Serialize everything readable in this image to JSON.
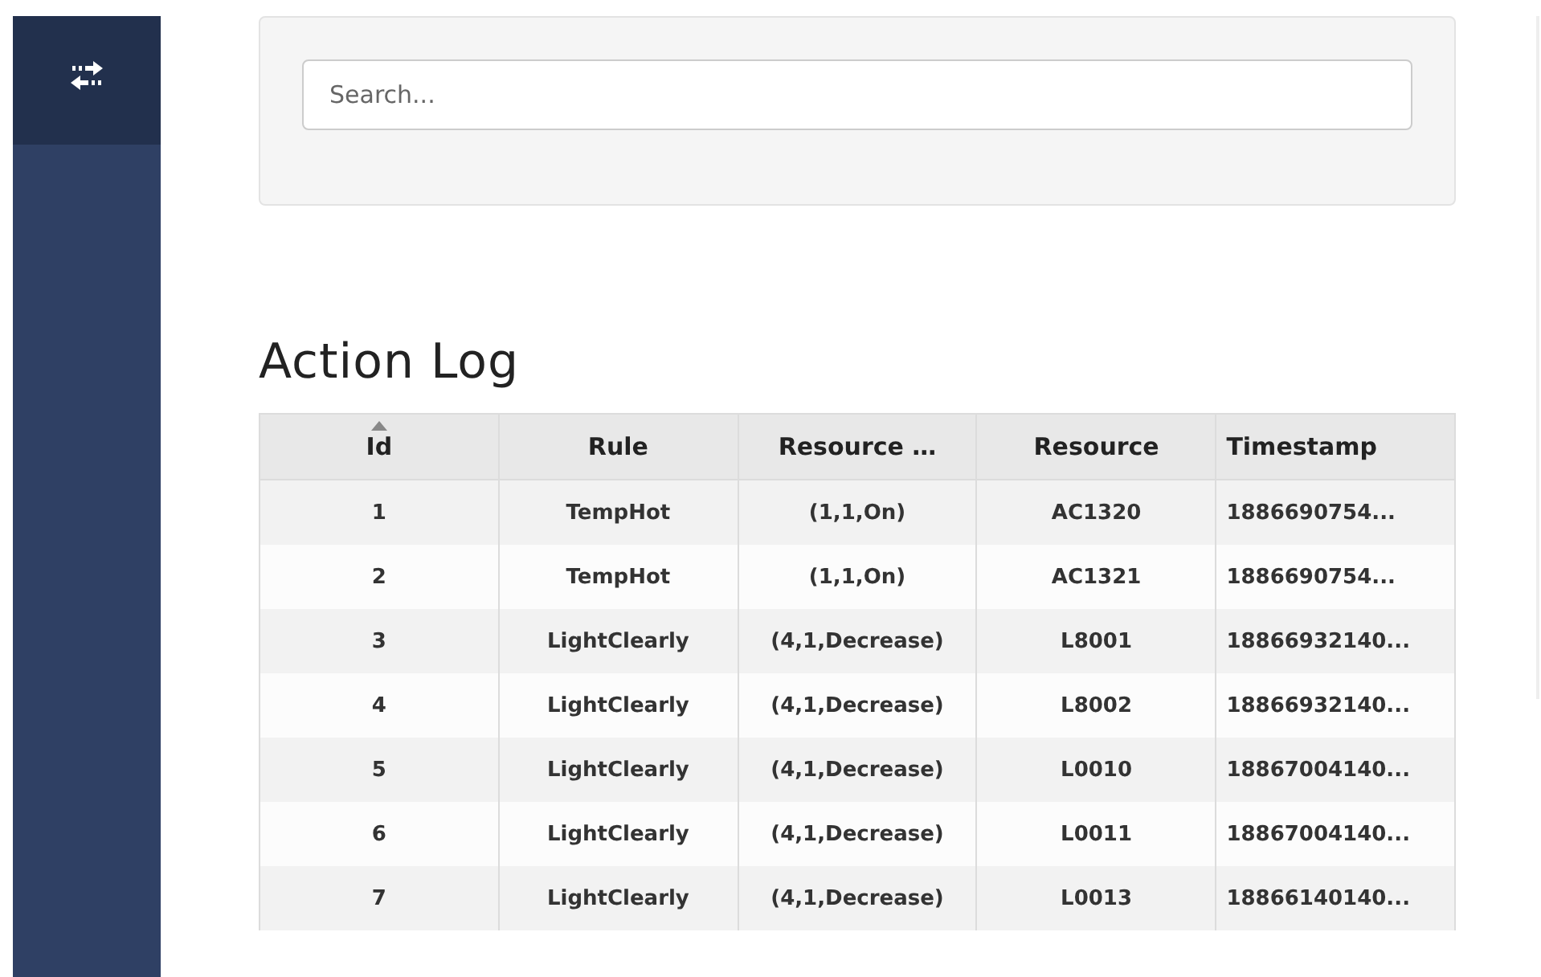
{
  "sidebar": {
    "items": [
      {
        "kind": "transfer",
        "selected": true
      }
    ]
  },
  "search": {
    "placeholder": "Search..."
  },
  "title": "Action Log",
  "table": {
    "columns": [
      {
        "label": "Id",
        "sorted": true
      },
      {
        "label": "Rule",
        "sorted": false
      },
      {
        "label": "Resource …",
        "sorted": false
      },
      {
        "label": "Resource",
        "sorted": false
      },
      {
        "label": "Timestamp",
        "sorted": false
      }
    ],
    "rows": [
      [
        "1",
        "TempHot",
        "(1,1,On)",
        "AC1320",
        "1886690754..."
      ],
      [
        "2",
        "TempHot",
        "(1,1,On)",
        "AC1321",
        "1886690754..."
      ],
      [
        "3",
        "LightClearly",
        "(4,1,Decrease)",
        "L8001",
        "18866932140..."
      ],
      [
        "4",
        "LightClearly",
        "(4,1,Decrease)",
        "L8002",
        "18866932140..."
      ],
      [
        "5",
        "LightClearly",
        "(4,1,Decrease)",
        "L0010",
        "18867004140..."
      ],
      [
        "6",
        "LightClearly",
        "(4,1,Decrease)",
        "L0011",
        "18867004140..."
      ],
      [
        "7",
        "LightClearly",
        "(4,1,Decrease)",
        "L0013",
        "18866140140..."
      ]
    ]
  }
}
